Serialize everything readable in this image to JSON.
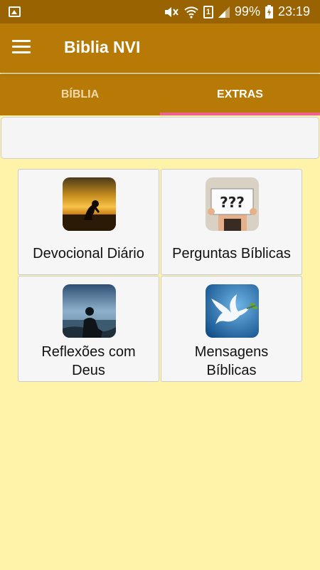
{
  "status_bar": {
    "battery": "99%",
    "time": "23:19",
    "sim_number": "1"
  },
  "app_bar": {
    "title": "Biblia NVI"
  },
  "tabs": [
    {
      "label": "BÍBLIA",
      "active": false
    },
    {
      "label": "EXTRAS",
      "active": true
    }
  ],
  "cards": [
    {
      "line1": "Devocional Diário",
      "line2": "",
      "icon": "praying-silhouette-sunset-icon"
    },
    {
      "line1": "Perguntas Bíblicas",
      "line2": "",
      "icon": "question-marks-sign-icon"
    },
    {
      "line1": "Reflexões com",
      "line2": "Deus",
      "icon": "man-overlooking-sea-icon"
    },
    {
      "line1": "Mensagens",
      "line2": "Bíblicas",
      "icon": "dove-with-olive-branch-icon"
    }
  ],
  "colors": {
    "status_bar": "#9a6302",
    "app_bar": "#b87a06",
    "tab_indicator": "#f06292",
    "background": "#fef3a8"
  }
}
